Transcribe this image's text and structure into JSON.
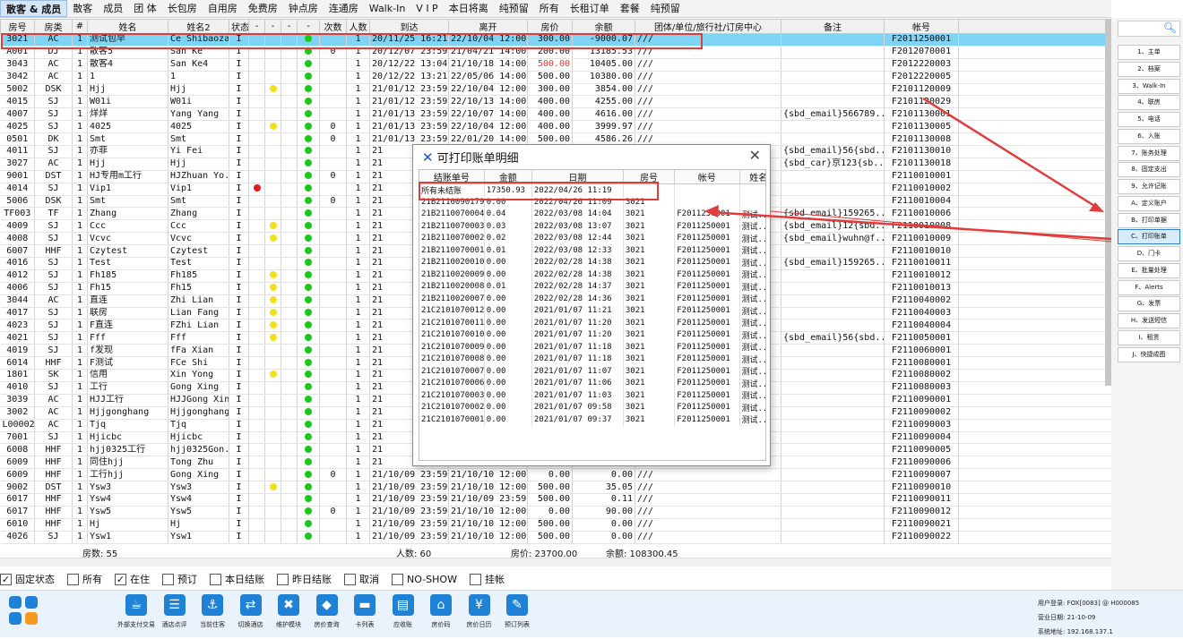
{
  "tabs": [
    "散客 & 成员",
    "散客",
    "成员",
    "团 体",
    "长包房",
    "自用房",
    "免费房",
    "钟点房",
    "连通房",
    "Walk-In",
    "V I P",
    "本日将离",
    "纯预留",
    "所有",
    "长租订单",
    "套餐",
    "纯预留"
  ],
  "grid": {
    "columns": [
      "房号",
      "房类",
      "#",
      "姓名",
      "姓名2",
      "状态",
      "-",
      "-",
      "-",
      "-",
      "次数",
      "人数",
      "到达",
      "离开",
      "房价",
      "余额",
      "团体/单位/旅行社/订房中心",
      "备注",
      "帐号"
    ],
    "rows": [
      [
        "3021",
        "AC",
        "1",
        "测试包早",
        "Ce Shibaozao",
        "I",
        "",
        "",
        "",
        "g",
        "",
        "1",
        "20/11/25 16:21",
        "22/10/04 12:00",
        "300.00",
        "-9000.07",
        "///",
        "",
        "F2011250001"
      ],
      [
        "A001",
        "DJ",
        "1",
        "散客5",
        "San Ke",
        "I",
        "",
        "",
        "",
        "g",
        "0",
        "1",
        "20/12/07 23:59",
        "21/04/21 14:00",
        "200.00",
        "13185.53",
        "///",
        "",
        "F2012070001"
      ],
      [
        "3043",
        "AC",
        "1",
        "散客4",
        "San Ke4",
        "I",
        "",
        "",
        "",
        "g",
        "",
        "1",
        "20/12/22 13:04",
        "21/10/18 14:00",
        "500.00",
        "10405.00",
        "///",
        "",
        "F2012220003"
      ],
      [
        "3042",
        "AC",
        "1",
        "1",
        "1",
        "I",
        "",
        "",
        "",
        "g",
        "",
        "1",
        "20/12/22 13:21",
        "22/05/06 14:00",
        "500.00",
        "10380.00",
        "///",
        "",
        "F2012220005"
      ],
      [
        "5002",
        "DSK",
        "1",
        "Hjj",
        "Hjj",
        "I",
        "",
        "y",
        "",
        "g",
        "",
        "1",
        "21/01/12 23:59",
        "22/10/04 12:00",
        "300.00",
        "3854.00",
        "///",
        "",
        "F2101120009"
      ],
      [
        "4015",
        "SJ",
        "1",
        "W01i",
        "W01i",
        "I",
        "",
        "",
        "",
        "g",
        "",
        "1",
        "21/01/12 23:59",
        "22/10/13 14:00",
        "400.00",
        "4255.00",
        "///",
        "",
        "F2101120029"
      ],
      [
        "4007",
        "SJ",
        "1",
        "烊烊",
        "Yang Yang",
        "I",
        "",
        "",
        "",
        "g",
        "",
        "1",
        "21/01/13 23:59",
        "22/10/07 14:00",
        "400.00",
        "4616.00",
        "///",
        "{sbd_email}566789...",
        "F2101130001"
      ],
      [
        "4025",
        "SJ",
        "1",
        "4025",
        "4025",
        "I",
        "",
        "y",
        "",
        "g",
        "0",
        "1",
        "21/01/13 23:59",
        "22/10/04 12:00",
        "400.00",
        "3999.97",
        "///",
        "",
        "F2101130005"
      ],
      [
        "0501",
        "DK",
        "1",
        "Smt",
        "Smt",
        "I",
        "",
        "",
        "",
        "g",
        "0",
        "1",
        "21/01/13 23:59",
        "22/01/20 14:00",
        "500.00",
        "4586.26",
        "///",
        "",
        "F2101130008"
      ],
      [
        "4011",
        "SJ",
        "1",
        "亦菲",
        "Yi Fei",
        "I",
        "",
        "",
        "",
        "g",
        "",
        "1",
        "21",
        "",
        "",
        "",
        "",
        "{sbd_email}56{sbd...",
        "F2101130010"
      ],
      [
        "3027",
        "AC",
        "1",
        "Hjj",
        "Hjj",
        "I",
        "",
        "",
        "",
        "g",
        "",
        "1",
        "21",
        "",
        "",
        "",
        "",
        "{sbd_car}京123{sb...",
        "F2101130018"
      ],
      [
        "9001",
        "DST",
        "1",
        "HJ专用m工行",
        "HJZhuan Yo...",
        "I",
        "",
        "",
        "",
        "g",
        "0",
        "1",
        "21",
        "",
        "",
        "",
        "",
        "",
        "F2110010001"
      ],
      [
        "4014",
        "SJ",
        "1",
        "Vip1",
        "Vip1",
        "I",
        "r",
        "",
        "",
        "g",
        "",
        "1",
        "21",
        "",
        "",
        "",
        "",
        "",
        "F2110010002"
      ],
      [
        "5006",
        "DSK",
        "1",
        "Smt",
        "Smt",
        "I",
        "",
        "",
        "",
        "g",
        "0",
        "1",
        "21",
        "",
        "",
        "",
        "",
        "",
        "F2110010004"
      ],
      [
        "TF003",
        "TF",
        "1",
        "Zhang",
        "Zhang",
        "I",
        "",
        "",
        "",
        "g",
        "",
        "1",
        "21",
        "",
        "",
        "",
        "",
        "{sbd_email}159265...",
        "F2110010006"
      ],
      [
        "4009",
        "SJ",
        "1",
        "Ccc",
        "Ccc",
        "I",
        "",
        "y",
        "",
        "g",
        "",
        "1",
        "21",
        "",
        "",
        "",
        "",
        "{sbd_email}12{sbd...",
        "F2110010008"
      ],
      [
        "4008",
        "SJ",
        "1",
        "Vcvc",
        "Vcvc",
        "I",
        "",
        "y",
        "",
        "g",
        "",
        "1",
        "21",
        "",
        "",
        "",
        "",
        "{sbd_email}wuhn@f...",
        "F2110010009"
      ],
      [
        "6007",
        "HHF",
        "1",
        "Czytest",
        "Czytest",
        "I",
        "",
        "",
        "",
        "g",
        "",
        "1",
        "21",
        "",
        "",
        "",
        "",
        "",
        "F2110010010"
      ],
      [
        "4016",
        "SJ",
        "1",
        "Test",
        "Test",
        "I",
        "",
        "",
        "",
        "g",
        "",
        "1",
        "21",
        "",
        "",
        "",
        "",
        "{sbd_email}159265...",
        "F2110010011"
      ],
      [
        "4012",
        "SJ",
        "1",
        "Fh185",
        "Fh185",
        "I",
        "",
        "y",
        "",
        "g",
        "",
        "1",
        "21",
        "",
        "",
        "",
        "",
        "",
        "F2110010012"
      ],
      [
        "4006",
        "SJ",
        "1",
        "Fh15",
        "Fh15",
        "I",
        "",
        "y",
        "",
        "g",
        "",
        "1",
        "21",
        "",
        "",
        "",
        "",
        "",
        "F2110010013"
      ],
      [
        "3044",
        "AC",
        "1",
        "直连",
        "Zhi Lian",
        "I",
        "",
        "y",
        "",
        "g",
        "",
        "1",
        "21",
        "",
        "",
        "",
        "",
        "",
        "F2110040002"
      ],
      [
        "4017",
        "SJ",
        "1",
        "联房",
        "Lian Fang",
        "I",
        "",
        "y",
        "",
        "g",
        "",
        "1",
        "21",
        "",
        "",
        "",
        "",
        "",
        "F2110040003"
      ],
      [
        "4023",
        "SJ",
        "1",
        "F直连",
        "FZhi Lian",
        "I",
        "",
        "y",
        "",
        "g",
        "",
        "1",
        "21",
        "",
        "",
        "",
        "",
        "",
        "F2110040004"
      ],
      [
        "4021",
        "SJ",
        "1",
        "Fff",
        "Fff",
        "I",
        "",
        "y",
        "",
        "g",
        "",
        "1",
        "21",
        "",
        "",
        "",
        "",
        "{sbd_email}56{sbd...",
        "F2110050001"
      ],
      [
        "4019",
        "SJ",
        "1",
        "f发现",
        "fFa Xian",
        "I",
        "",
        "",
        "",
        "g",
        "",
        "1",
        "21",
        "",
        "",
        "",
        "",
        "",
        "F2110060001"
      ],
      [
        "6014",
        "HHF",
        "1",
        "F测试",
        "FCe Shi",
        "I",
        "",
        "",
        "",
        "g",
        "",
        "1",
        "21",
        "",
        "",
        "",
        "",
        "",
        "F2110080001"
      ],
      [
        "1801",
        "SK",
        "1",
        "信用",
        "Xin Yong",
        "I",
        "",
        "y",
        "",
        "g",
        "",
        "1",
        "21",
        "",
        "",
        "",
        "",
        "",
        "F2110080002"
      ],
      [
        "4010",
        "SJ",
        "1",
        "工行",
        "Gong Xing",
        "I",
        "",
        "",
        "",
        "g",
        "",
        "1",
        "21",
        "",
        "",
        "",
        "",
        "",
        "F2110080003"
      ],
      [
        "3039",
        "AC",
        "1",
        "HJJ工行",
        "HJJGong Xing",
        "I",
        "",
        "",
        "",
        "g",
        "",
        "1",
        "21",
        "",
        "",
        "",
        "",
        "",
        "F2110090001"
      ],
      [
        "3002",
        "AC",
        "1",
        "Hjjgonghang",
        "Hjjgonghang",
        "I",
        "",
        "",
        "",
        "g",
        "",
        "1",
        "21",
        "",
        "",
        "",
        "",
        "",
        "F2110090002"
      ],
      [
        "L00002",
        "AC",
        "1",
        "Tjq",
        "Tjq",
        "I",
        "",
        "",
        "",
        "g",
        "",
        "1",
        "21",
        "",
        "",
        "",
        "",
        "",
        "F2110090003"
      ],
      [
        "7001",
        "SJ",
        "1",
        "Hjicbc",
        "Hjicbc",
        "I",
        "",
        "",
        "",
        "g",
        "",
        "1",
        "21",
        "",
        "",
        "",
        "",
        "",
        "F2110090004"
      ],
      [
        "6008",
        "HHF",
        "1",
        "hjj0325工行",
        "hjj0325Gon...",
        "I",
        "",
        "",
        "",
        "g",
        "",
        "1",
        "21",
        "",
        "",
        "",
        "",
        "",
        "F2110090005"
      ],
      [
        "6009",
        "HHF",
        "1",
        "同住hjj",
        "Tong Zhu",
        "I",
        "",
        "",
        "",
        "g",
        "",
        "1",
        "21",
        "",
        "",
        "",
        "",
        "",
        "F2110090006"
      ],
      [
        "6009",
        "HHF",
        "1",
        "工行hjj",
        "Gong Xing",
        "I",
        "",
        "",
        "",
        "g",
        "0",
        "1",
        "21/10/09 23:59",
        "21/10/10 12:00",
        "0.00",
        "0.00",
        "///",
        "",
        "F2110090007"
      ],
      [
        "9002",
        "DST",
        "1",
        "Ysw3",
        "Ysw3",
        "I",
        "",
        "y",
        "",
        "g",
        "",
        "1",
        "21/10/09 23:59",
        "21/10/10 12:00",
        "500.00",
        "35.05",
        "///",
        "",
        "F2110090010"
      ],
      [
        "6017",
        "HHF",
        "1",
        "Ysw4",
        "Ysw4",
        "I",
        "",
        "",
        "",
        "g",
        "",
        "1",
        "21/10/09 23:59",
        "21/10/09 23:59",
        "500.00",
        "0.11",
        "///",
        "",
        "F2110090011"
      ],
      [
        "6017",
        "HHF",
        "1",
        "Ysw5",
        "Ysw5",
        "I",
        "",
        "",
        "",
        "g",
        "0",
        "1",
        "21/10/09 23:59",
        "21/10/10 12:00",
        "0.00",
        "90.00",
        "///",
        "",
        "F2110090012"
      ],
      [
        "6010",
        "HHF",
        "1",
        "Hj",
        "Hj",
        "I",
        "",
        "",
        "",
        "g",
        "",
        "1",
        "21/10/09 23:59",
        "21/10/10 12:00",
        "500.00",
        "0.00",
        "///",
        "",
        "F2110090021"
      ],
      [
        "4026",
        "SJ",
        "1",
        "Ysw1",
        "Ysw1",
        "I",
        "",
        "",
        "",
        "g",
        "",
        "1",
        "21/10/09 23:59",
        "21/10/10 12:00",
        "500.00",
        "0.00",
        "///",
        "",
        "F2110090022"
      ]
    ]
  },
  "summary": {
    "rooms": "房数: 55",
    "people": "人数: 60",
    "rate": "房价: 23700.00",
    "balance": "余额: 108300.45"
  },
  "filters": [
    {
      "label": "固定状态",
      "checked": true
    },
    {
      "label": "所有",
      "checked": false
    },
    {
      "label": "在住",
      "checked": true
    },
    {
      "label": "预订",
      "checked": false
    },
    {
      "label": "本日结账",
      "checked": false
    },
    {
      "label": "昨日结账",
      "checked": false
    },
    {
      "label": "取消",
      "checked": false
    },
    {
      "label": "NO-SHOW",
      "checked": false
    },
    {
      "label": "挂帐",
      "checked": false
    }
  ],
  "right_panel": {
    "items": [
      "1、主单",
      "2、档案",
      "3、Walk-In",
      "4、联房",
      "5、电话",
      "6、入账",
      "7、账务处理",
      "8、固定支出",
      "9、允许记账",
      "A、定义账户",
      "B、打印单据",
      "C、打印账单",
      "D、门卡",
      "E、批量处理",
      "F、Alerts",
      "G、发票",
      "H、发送短信",
      "I、租赁",
      "J、快捷成图"
    ],
    "highlight": "C、打印账单"
  },
  "dialog": {
    "title": "可打印账单明细",
    "columns": [
      "结账单号",
      "金额",
      "日期",
      "房号",
      "帐号",
      "姓名"
    ],
    "rows": [
      [
        "所有未结账",
        "17350.93",
        "2022/04/26 11:19",
        "",
        "",
        ""
      ],
      [
        "21B2110090179",
        "0.00",
        "2022/04/26 11:09",
        "3021",
        "",
        ""
      ],
      [
        "21B2110070004",
        "0.04",
        "2022/03/08 14:04",
        "3021",
        "F2011250001",
        "测试.."
      ],
      [
        "21B2110070003",
        "0.03",
        "2022/03/08 13:07",
        "3021",
        "F2011250001",
        "测试.."
      ],
      [
        "21B2110070002",
        "0.02",
        "2022/03/08 12:44",
        "3021",
        "F2011250001",
        "测试.."
      ],
      [
        "21B2110070001",
        "0.01",
        "2022/03/08 12:33",
        "3021",
        "F2011250001",
        "测试.."
      ],
      [
        "21B2110020010",
        "0.00",
        "2022/02/28 14:38",
        "3021",
        "F2011250001",
        "测试.."
      ],
      [
        "21B2110020009",
        "0.00",
        "2022/02/28 14:38",
        "3021",
        "F2011250001",
        "测试.."
      ],
      [
        "21B2110020008",
        "0.01",
        "2022/02/28 14:37",
        "3021",
        "F2011250001",
        "测试.."
      ],
      [
        "21B2110020007",
        "0.00",
        "2022/02/28 14:36",
        "3021",
        "F2011250001",
        "测试.."
      ],
      [
        "21C2101070012",
        "0.00",
        "2021/01/07 11:21",
        "3021",
        "F2011250001",
        "测试.."
      ],
      [
        "21C2101070011",
        "0.00",
        "2021/01/07 11:20",
        "3021",
        "F2011250001",
        "测试.."
      ],
      [
        "21C2101070010",
        "0.00",
        "2021/01/07 11:20",
        "3021",
        "F2011250001",
        "测试.."
      ],
      [
        "21C2101070009",
        "0.00",
        "2021/01/07 11:18",
        "3021",
        "F2011250001",
        "测试.."
      ],
      [
        "21C2101070008",
        "0.00",
        "2021/01/07 11:18",
        "3021",
        "F2011250001",
        "测试.."
      ],
      [
        "21C2101070007",
        "0.00",
        "2021/01/07 11:07",
        "3021",
        "F2011250001",
        "测试.."
      ],
      [
        "21C2101070006",
        "0.00",
        "2021/01/07 11:06",
        "3021",
        "F2011250001",
        "测试.."
      ],
      [
        "21C2101070003",
        "0.00",
        "2021/01/07 11:03",
        "3021",
        "F2011250001",
        "测试.."
      ],
      [
        "21C2101070002",
        "0.00",
        "2021/01/07 09:58",
        "3021",
        "F2011250001",
        "测试.."
      ],
      [
        "21C2101070001",
        "0.00",
        "2021/01/07 09:37",
        "3021",
        "F2011250001",
        "测试.."
      ]
    ]
  },
  "dock": [
    "外部支付交易",
    "酒店点评",
    "当前住客",
    "切换酒店",
    "维护模块",
    "房价查询",
    "卡列表",
    "应收账",
    "房价码",
    "房价日历",
    "预订列表"
  ],
  "user": {
    "login": "用户登录: FOX[0083] @ H000085",
    "biz_date": "营业日期: 21-10-09",
    "system": "系统地址: 192.168.137.1"
  }
}
